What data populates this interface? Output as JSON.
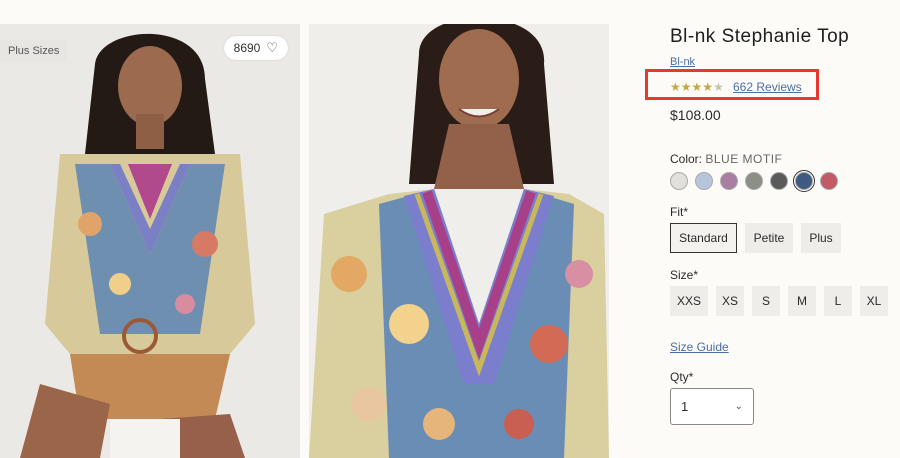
{
  "gallery": {
    "tag": "Plus Sizes",
    "likes_count": "8690"
  },
  "product": {
    "title": "Bl-nk Stephanie Top",
    "brand": "Bl-nk",
    "rating": 4.5,
    "reviews_label": "662 Reviews",
    "price": "$108.00"
  },
  "color": {
    "label": "Color:",
    "selected": "BLUE MOTIF",
    "swatches": [
      "#e2e0dc",
      "#b8c4dc",
      "#a97ea0",
      "#8b8f86",
      "#5a5a5a",
      "#3e5a82",
      "#c25b66"
    ]
  },
  "fit": {
    "label": "Fit*",
    "options": [
      "Standard",
      "Petite",
      "Plus"
    ]
  },
  "size": {
    "label": "Size*",
    "options": [
      "XXS",
      "XS",
      "S",
      "M",
      "L",
      "XL"
    ]
  },
  "size_guide": "Size Guide",
  "qty": {
    "label": "Qty*",
    "value": "1"
  },
  "colors": {
    "highlight": "#e53a2d",
    "link": "#4a6fa5",
    "star": "#c9a444"
  }
}
